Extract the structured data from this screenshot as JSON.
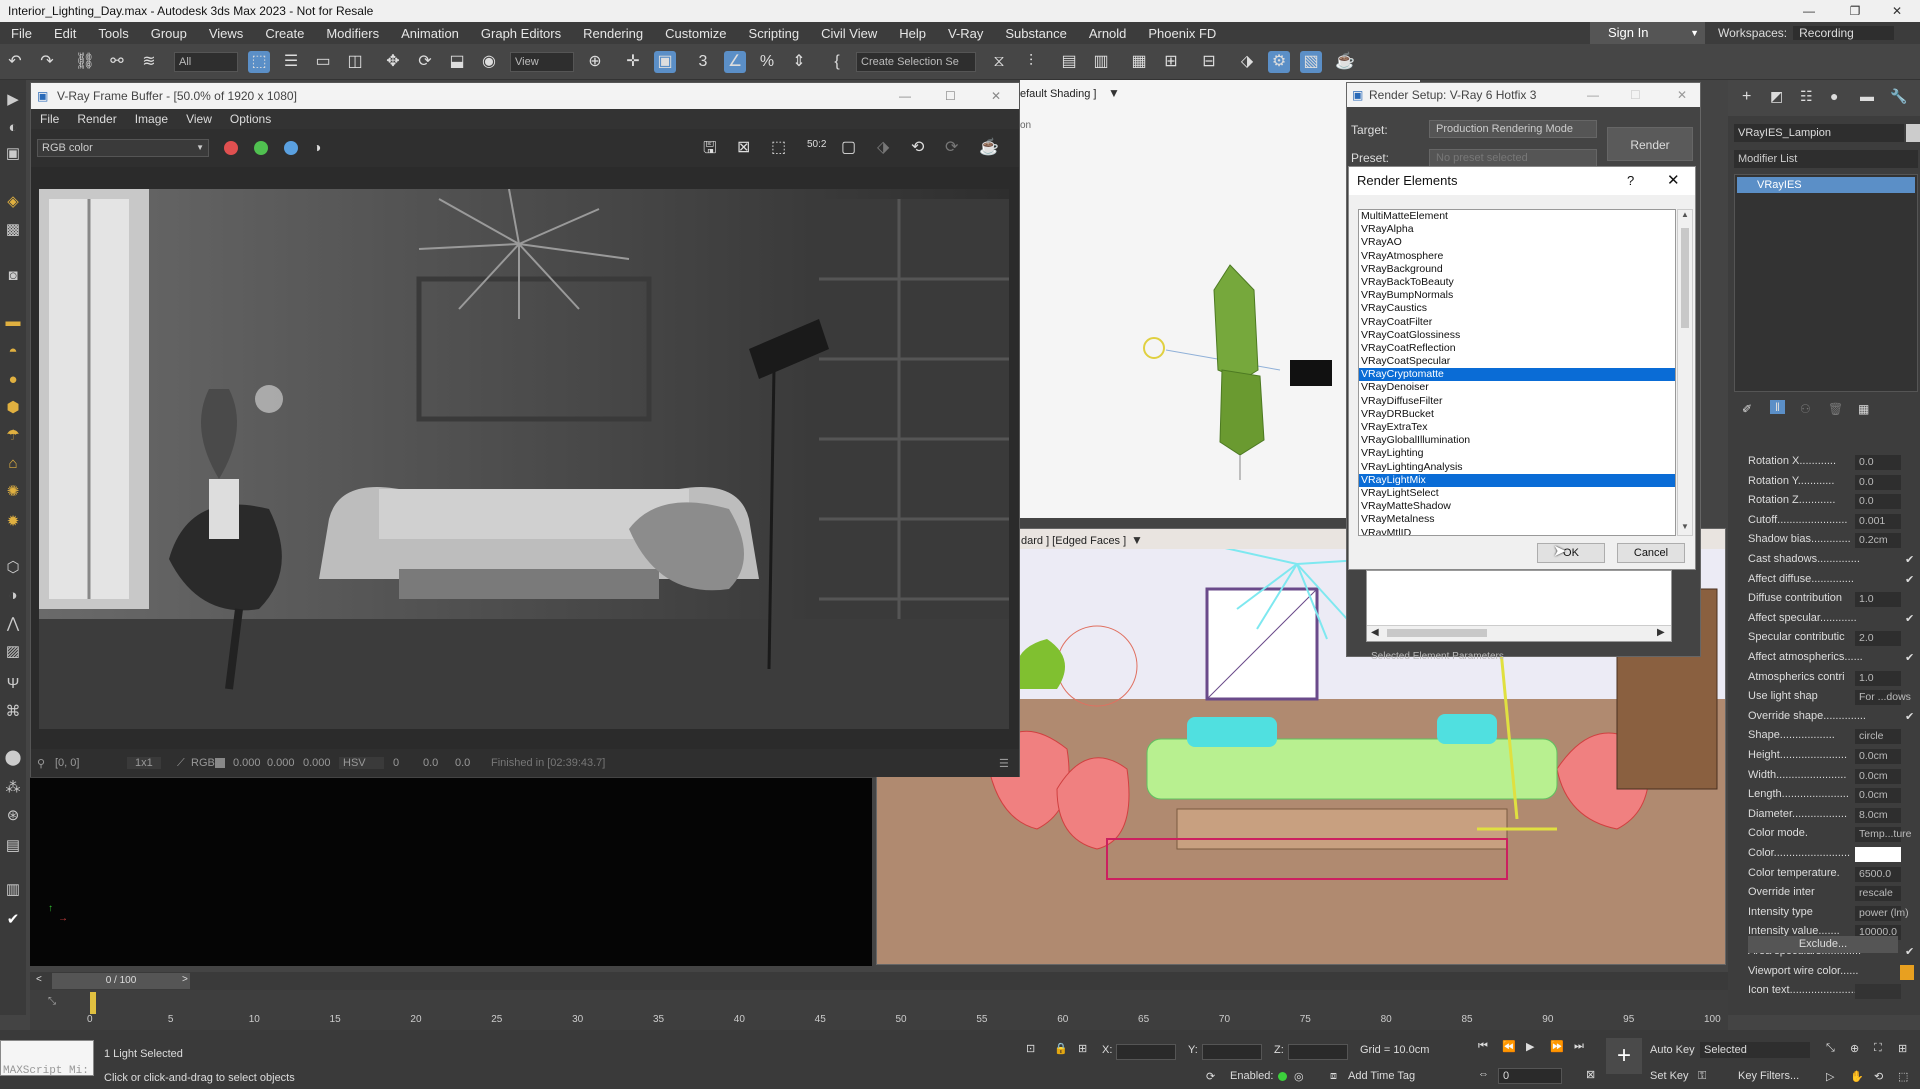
{
  "window": {
    "title": "Interior_Lighting_Day.max - Autodesk 3ds Max 2023 - Not for Resale"
  },
  "menu": [
    "File",
    "Edit",
    "Tools",
    "Group",
    "Views",
    "Create",
    "Modifiers",
    "Animation",
    "Graph Editors",
    "Rendering",
    "Customize",
    "Scripting",
    "Civil View",
    "Help",
    "V-Ray",
    "Substance",
    "Arnold",
    "Phoenix FD"
  ],
  "account": {
    "sign_in": "Sign In",
    "workspaces_label": "Workspaces:",
    "workspace": "Recording"
  },
  "toolbar": {
    "filter": "All",
    "ref_coord": "View",
    "selection_set": "Create Selection Se"
  },
  "vfb": {
    "title": "V-Ray Frame Buffer - [50.0% of 1920 x 1080]",
    "menu": [
      "File",
      "Render",
      "Image",
      "View",
      "Options"
    ],
    "channel": "RGB color",
    "channel_colors": [
      "#e05050",
      "#50c050",
      "#5aa0e0"
    ],
    "status": {
      "coords": "[0, 0]",
      "zoom": "1x1",
      "mode": "RGB",
      "r": "0.000",
      "g": "0.000",
      "b": "0.000",
      "space": "HSV",
      "h": "0",
      "s": "0.0",
      "v": "0.0",
      "finished": "Finished in [02:39:43.7]"
    }
  },
  "viewports": {
    "top_label": "efault Shading ]",
    "top_sub": "on",
    "persp_label": "dard ] [Edged Faces ]"
  },
  "render_setup": {
    "title": "Render Setup: V-Ray 6 Hotfix 3",
    "target_label": "Target:",
    "target_value": "Production Rendering Mode",
    "preset_label": "Preset:",
    "preset_value": "No preset selected",
    "render_button": "Render",
    "sel_params": "Selected Element Parameters"
  },
  "render_elements": {
    "title": "Render Elements",
    "help": "?",
    "items": [
      "MultiMatteElement",
      "VRayAlpha",
      "VRayAO",
      "VRayAtmosphere",
      "VRayBackground",
      "VRayBackToBeauty",
      "VRayBumpNormals",
      "VRayCaustics",
      "VRayCoatFilter",
      "VRayCoatGlossiness",
      "VRayCoatReflection",
      "VRayCoatSpecular",
      "VRayCryptomatte",
      "VRayDenoiser",
      "VRayDiffuseFilter",
      "VRayDRBucket",
      "VRayExtraTex",
      "VRayGlobalIllumination",
      "VRayLighting",
      "VRayLightingAnalysis",
      "VRayLightMix",
      "VRayLightSelect",
      "VRayMatteShadow",
      "VRayMetalness",
      "VRayMtlID"
    ],
    "selected": [
      12,
      20
    ],
    "ok": "OK",
    "cancel": "Cancel"
  },
  "command_panel": {
    "object_name": "VRayIES_Lampion",
    "modifier_list": "Modifier List",
    "stack_item": "VRayIES",
    "params": [
      {
        "label": "Rotation X............",
        "value": "0.0"
      },
      {
        "label": "Rotation Y............",
        "value": "0.0"
      },
      {
        "label": "Rotation Z............",
        "value": "0.0"
      },
      {
        "label": "Cutoff.......................",
        "value": "0.001"
      },
      {
        "label": "Shadow bias.............",
        "value": "0.2cm"
      },
      {
        "label": "Cast shadows..............",
        "check": "✔"
      },
      {
        "label": "Affect diffuse..............",
        "check": "✔"
      },
      {
        "label": "Diffuse contribution",
        "value": "1.0"
      },
      {
        "label": "Affect specular............",
        "check": "✔"
      },
      {
        "label": "Specular contributic",
        "value": "2.0"
      },
      {
        "label": "Affect atmospherics......",
        "check": "✔"
      },
      {
        "label": "Atmospherics contri",
        "value": "1.0"
      },
      {
        "label": "Use light shap",
        "value": "For ...dows"
      },
      {
        "label": "Override shape..............",
        "check": "✔"
      },
      {
        "label": "Shape..................",
        "value": "circle"
      },
      {
        "label": "Height......................",
        "value": "0.0cm"
      },
      {
        "label": "Width.......................",
        "value": "0.0cm"
      },
      {
        "label": "Length......................",
        "value": "0.0cm"
      },
      {
        "label": "Diameter..................",
        "value": "8.0cm"
      },
      {
        "label": "Color mode.",
        "value": "Temp...ture"
      },
      {
        "label": "Color.........................",
        "value": ""
      },
      {
        "label": "Color temperature.",
        "value": "6500.0"
      },
      {
        "label": "Override inter",
        "value": "rescale"
      },
      {
        "label": "Intensity type",
        "value": "power (lm)"
      },
      {
        "label": "Intensity value.......",
        "value": "10000.0"
      },
      {
        "label": "Area speculars.............",
        "check": "✔"
      },
      {
        "label": "Viewport wire color......",
        "value": ""
      },
      {
        "label": "Icon text........................",
        "value": ""
      }
    ],
    "exclude": "Exclude..."
  },
  "timeline": {
    "frame": "0 / 100",
    "ticks": [
      "0",
      "5",
      "10",
      "15",
      "20",
      "25",
      "30",
      "35",
      "40",
      "45",
      "50",
      "55",
      "60",
      "65",
      "70",
      "75",
      "80",
      "85",
      "90",
      "95",
      "100"
    ]
  },
  "status": {
    "maxscript": "MAXScript Mi:",
    "selected": "1 Light Selected",
    "hint": "Click or click-and-drag to select objects",
    "x_label": "X:",
    "y_label": "Y:",
    "z_label": "Z:",
    "grid": "Grid = 10.0cm",
    "enabled": "Enabled:",
    "add_time_tag": "Add Time Tag",
    "auto_key": "Auto Key",
    "selected_dd": "Selected",
    "set_key": "Set Key",
    "key_filters": "Key Filters...",
    "frame_input": "0"
  }
}
